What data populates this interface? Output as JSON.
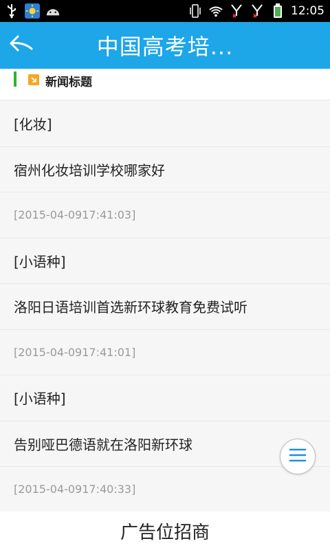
{
  "status_bar": {
    "time": "12:05",
    "icons": [
      "usb-icon",
      "weather-sun-icon",
      "android-icon",
      "vibrate-icon",
      "wifi-icon",
      "signal-icon",
      "signal-icon",
      "battery-icon"
    ]
  },
  "header": {
    "title": "中国高考培...",
    "back_icon": "back-arrow-icon"
  },
  "section": {
    "title": "新闻标题",
    "accent_color": "#2db52d",
    "icon_color": "#f6a623"
  },
  "news": [
    {
      "category": "[化妆]",
      "title": "宿州化妆培训学校哪家好",
      "time": "[2015-04-0917:41:03]"
    },
    {
      "category": "[小语种]",
      "title": "洛阳日语培训首选新环球教育免费试听",
      "time": "[2015-04-0917:41:01]"
    },
    {
      "category": "[小语种]",
      "title": "告别哑巴德语就在洛阳新环球",
      "time": "[2015-04-0917:40:33]"
    }
  ],
  "fab": {
    "icon": "menu-icon"
  },
  "ad": {
    "text": "广告位招商"
  },
  "colors": {
    "header_bg": "#1da6e8",
    "fab_icon": "#1d8fe0"
  }
}
